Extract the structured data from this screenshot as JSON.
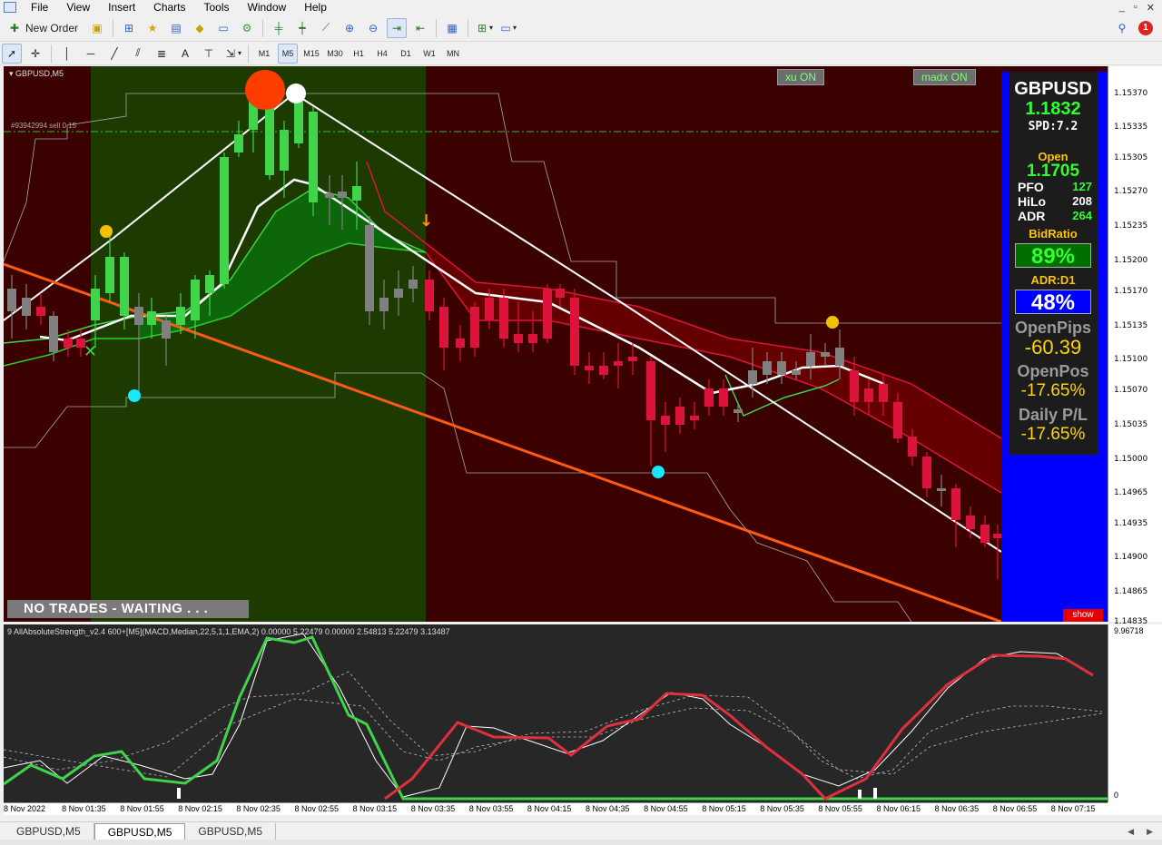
{
  "menubar": {
    "items": [
      "File",
      "View",
      "Insert",
      "Charts",
      "Tools",
      "Window",
      "Help"
    ],
    "window_controls": [
      "_",
      "▫",
      "✕"
    ]
  },
  "toolbar": {
    "new_order_label": "New Order",
    "notification_count": "1",
    "timeframes": [
      "M1",
      "M5",
      "M15",
      "M30",
      "H1",
      "H4",
      "D1",
      "W1",
      "MN"
    ],
    "active_timeframe": "M5"
  },
  "chart": {
    "label": "GBPUSD,M5",
    "order_line_label": "#93942994 sell 0.15",
    "toggle_xu": "xu ON",
    "toggle_madx": "madx ON",
    "status_banner": "NO TRADES - WAITING . . .",
    "show_button": "show",
    "price_ticks": [
      "1.15370",
      "1.15335",
      "1.15305",
      "1.15270",
      "1.15235",
      "1.15200",
      "1.15170",
      "1.15135",
      "1.15100",
      "1.15070",
      "1.15035",
      "1.15000",
      "1.14965",
      "1.14935",
      "1.14900",
      "1.14865",
      "1.14835"
    ],
    "colors": {
      "bull": "#3fd44a",
      "bear": "#dc143c",
      "neutral": "#808080",
      "green_zone": "#1d3b00",
      "red_zone": "#3b0000",
      "trend_line": "#ff5a14"
    }
  },
  "info_panel": {
    "symbol": "GBPUSD",
    "price": "1.1832",
    "spread": "SPD:7.2",
    "open_label": "Open",
    "open_value": "1.1705",
    "rows": [
      {
        "key": "PFO",
        "value": "127"
      },
      {
        "key": "HiLo",
        "value": "208"
      },
      {
        "key": "ADR",
        "value": "264"
      }
    ],
    "bid_ratio_label": "BidRatio",
    "bid_ratio_value": "89%",
    "adr_d1_label": "ADR:D1",
    "adr_d1_value": "48%",
    "open_pips_label": "OpenPips",
    "open_pips_value": "-60.39",
    "open_pos_label": "OpenPos",
    "open_pos_value": "-17.65%",
    "daily_pl_label": "Daily P/L",
    "daily_pl_value": "-17.65%"
  },
  "indicator": {
    "label": "9 AllAbsoluteStrength_v2.4 600+[M5](MACD,Median,22,5,1,1,EMA,2) 0.00000 5.22479 0.00000 2.54813 5.22479 3.13487",
    "axis_max": "9.96718",
    "axis_min": "0"
  },
  "time_axis": {
    "ticks": [
      "8 Nov 2022",
      "8 Nov 01:35",
      "8 Nov 01:55",
      "8 Nov 02:15",
      "8 Nov 02:35",
      "8 Nov 02:55",
      "8 Nov 03:15",
      "8 Nov 03:35",
      "8 Nov 03:55",
      "8 Nov 04:15",
      "8 Nov 04:35",
      "8 Nov 04:55",
      "8 Nov 05:15",
      "8 Nov 05:35",
      "8 Nov 05:55",
      "8 Nov 06:15",
      "8 Nov 06:35",
      "8 Nov 06:55",
      "8 Nov 07:15"
    ]
  },
  "tabs": [
    {
      "label": "GBPUSD,M5",
      "active": false
    },
    {
      "label": "GBPUSD,M5",
      "active": true
    },
    {
      "label": "GBPUSD,M5",
      "active": false
    }
  ]
}
